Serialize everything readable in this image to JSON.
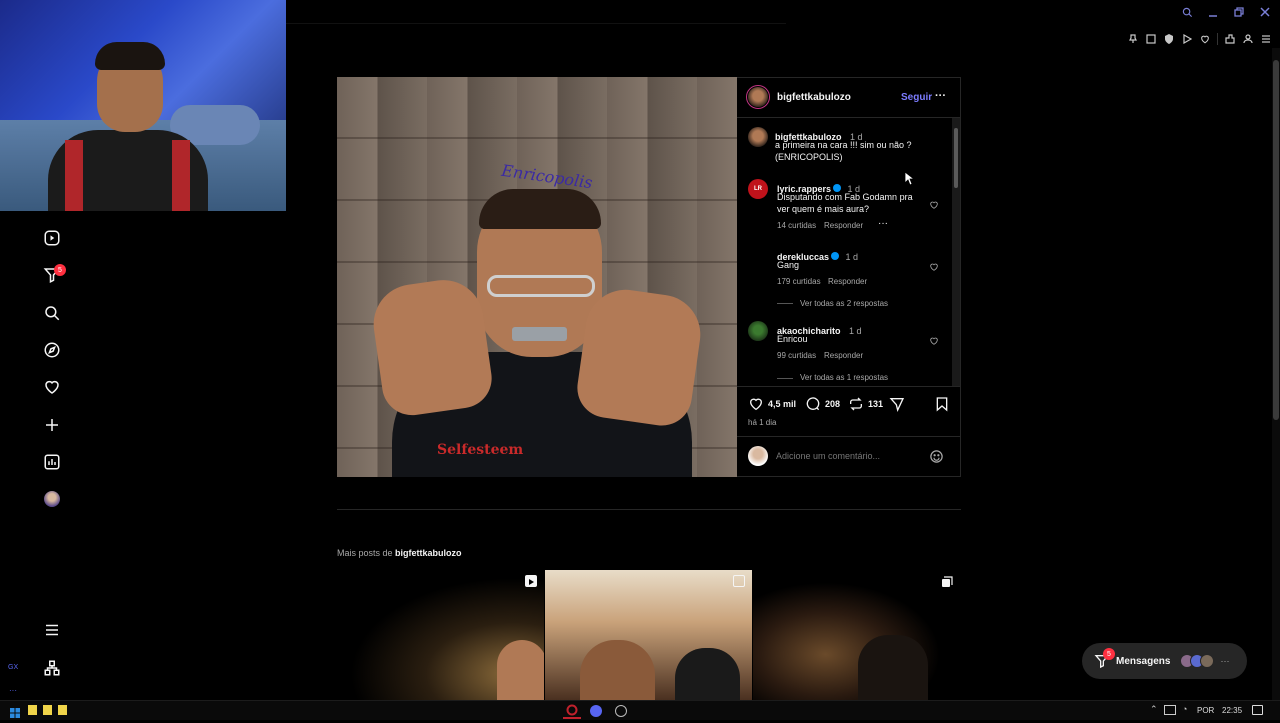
{
  "colors": {
    "accent": "#0095f6",
    "follow": "#7c7cff",
    "badge": "#ff3040",
    "background": "#000000",
    "border": "#262626"
  },
  "rail": {
    "notifications_badge": "5",
    "items": [
      {
        "icon": "reels-icon"
      },
      {
        "icon": "filter-icon"
      },
      {
        "icon": "search-icon"
      },
      {
        "icon": "compass-icon"
      },
      {
        "icon": "heart-icon"
      },
      {
        "icon": "plus-icon"
      },
      {
        "icon": "stats-icon"
      },
      {
        "icon": "avatar"
      }
    ],
    "bottom_small": "GX"
  },
  "post": {
    "image_tattoo_text": "Enricopolis",
    "image_shirt_text": "Selfesteem",
    "author": "bigfettkabulozo",
    "follow_label": "Seguir",
    "more_label": "···",
    "caption": {
      "user": "bigfettkabulozo",
      "time": "1 d",
      "line1": "a primeira na cara !!! sim ou não ?",
      "line2": "(ENRICOPOLIS)"
    },
    "comments": [
      {
        "user": "lyric.rappers",
        "verified": true,
        "time": "1 d",
        "text1": "Disputando com Fab Godamn pra",
        "text2": "ver quem é mais aura?",
        "likes": "14 curtidas",
        "reply": "Responder",
        "more": "···",
        "view_replies": ""
      },
      {
        "user": "derekluccas",
        "verified": true,
        "time": "1 d",
        "text1": "Gang",
        "text2": "",
        "likes": "179 curtidas",
        "reply": "Responder",
        "more": "",
        "view_replies": "Ver todas as 2 respostas"
      },
      {
        "user": "akaochicharito",
        "verified": false,
        "time": "1 d",
        "text1": "Enricou",
        "text2": "",
        "likes": "99 curtidas",
        "reply": "Responder",
        "more": "",
        "view_replies": "Ver todas as 1 respostas"
      }
    ],
    "likes_count": "4,5 mil",
    "comments_count": "208",
    "reposts_count": "131",
    "posted_ago": "há 1 dia",
    "comment_placeholder": "Adicione um comentário..."
  },
  "more_posts": {
    "prefix": "Mais posts de",
    "user": "bigfettkabulozo"
  },
  "messages": {
    "label": "Mensagens",
    "badge": "5",
    "more": "···"
  },
  "taskbar": {
    "lang": "POR",
    "time": "22:35"
  }
}
